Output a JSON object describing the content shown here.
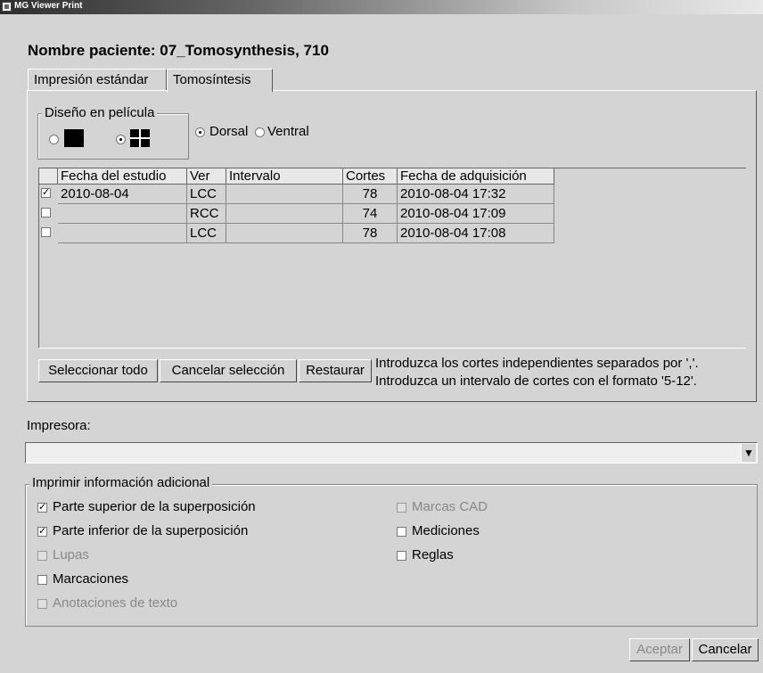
{
  "window": {
    "title": "MG Viewer Print"
  },
  "patient_label": "Nombre paciente: 07_Tomosynthesis, 710",
  "tabs": [
    {
      "label": "Impresión estándar"
    },
    {
      "label": "Tomosíntesis"
    }
  ],
  "film_layout": {
    "legend": "Diseño en película",
    "orientation": {
      "dorsal": "Dorsal",
      "ventral": "Ventral",
      "selected": "Dorsal"
    },
    "selected_layout": "4-up"
  },
  "table": {
    "columns": [
      "Fecha del estudio",
      "Ver",
      "Intervalo",
      "Cortes",
      "Fecha de adquisición"
    ],
    "rows": [
      {
        "checked": true,
        "date": "2010-08-04",
        "view": "LCC",
        "interval": "",
        "slices": "78",
        "acquired": "2010-08-04 17:32"
      },
      {
        "checked": false,
        "date": "",
        "view": "RCC",
        "interval": "",
        "slices": "74",
        "acquired": "2010-08-04 17:09"
      },
      {
        "checked": false,
        "date": "",
        "view": "LCC",
        "interval": "",
        "slices": "78",
        "acquired": "2010-08-04 17:08"
      }
    ]
  },
  "buttons": {
    "select_all": "Seleccionar todo",
    "cancel_selection": "Cancelar selección",
    "restore": "Restaurar",
    "accept": "Aceptar",
    "cancel": "Cancelar"
  },
  "hint": {
    "line1": "Introduzca los cortes independientes separados por ','.",
    "line2": "Introduzca un intervalo de cortes con el formato '5-12'."
  },
  "printer": {
    "label": "Impresora:",
    "value": ""
  },
  "additional_info": {
    "legend": "Imprimir información adicional",
    "options": [
      {
        "label": "Parte superior de la superposición",
        "checked": true,
        "enabled": true
      },
      {
        "label": "Parte inferior de la superposición",
        "checked": true,
        "enabled": true
      },
      {
        "label": "Lupas",
        "checked": false,
        "enabled": false
      },
      {
        "label": "Marcaciones",
        "checked": false,
        "enabled": true
      },
      {
        "label": "Anotaciones de texto",
        "checked": false,
        "enabled": false
      },
      {
        "label": "Marcas CAD",
        "checked": false,
        "enabled": false
      },
      {
        "label": "Mediciones",
        "checked": false,
        "enabled": true
      },
      {
        "label": "Reglas",
        "checked": false,
        "enabled": true
      }
    ]
  },
  "icons": {
    "check_mark": "✓",
    "dropdown_arrow": "▼"
  }
}
